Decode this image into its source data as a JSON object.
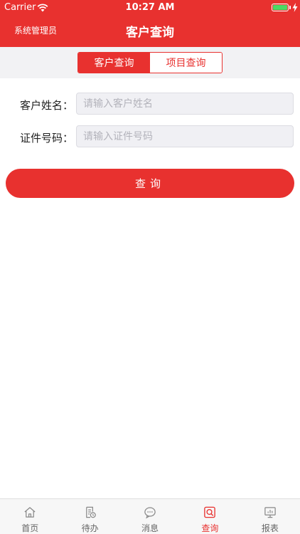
{
  "status_bar": {
    "carrier": "Carrier",
    "time": "10:27 AM"
  },
  "nav": {
    "user_label": "系统管理员",
    "title": "客户查询"
  },
  "segments": [
    {
      "label": "客户查询",
      "active": true
    },
    {
      "label": "项目查询",
      "active": false
    }
  ],
  "form": {
    "name_label": "客户姓名：",
    "name_placeholder": "请输入客户姓名",
    "name_value": "",
    "id_label": "证件号码：",
    "id_placeholder": "请输入证件号码",
    "id_value": ""
  },
  "query_button": "查询",
  "bottom_tabs": [
    {
      "label": "首页",
      "icon": "home-icon",
      "active": false
    },
    {
      "label": "待办",
      "icon": "todo-icon",
      "active": false
    },
    {
      "label": "消息",
      "icon": "message-icon",
      "active": false
    },
    {
      "label": "查询",
      "icon": "search-icon",
      "active": true
    },
    {
      "label": "报表",
      "icon": "report-icon",
      "active": false
    }
  ],
  "colors": {
    "brand_red": "#e8312f",
    "battery_green": "#4cd964",
    "inactive_tab": "#666666"
  }
}
